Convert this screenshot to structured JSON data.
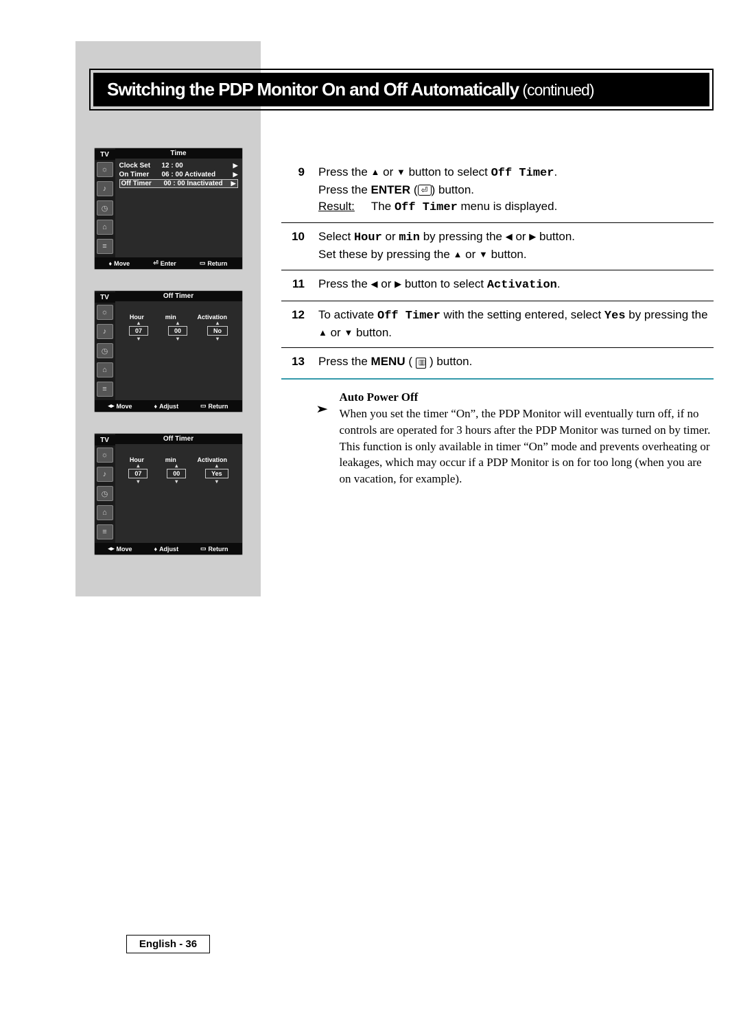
{
  "title_main": "Switching the PDP Monitor On and Off Automatically",
  "title_cont": " (continued)",
  "osd1": {
    "tv": "TV",
    "header": "Time",
    "rows": [
      {
        "label": "Clock Set",
        "value": "12 : 00"
      },
      {
        "label": "On Timer",
        "value": "06 : 00  Activated"
      },
      {
        "label": "Off Timer",
        "value": "00 : 00  Inactivated"
      }
    ],
    "footer": {
      "move": "Move",
      "mid": "Enter",
      "ret": "Return"
    }
  },
  "osd2": {
    "tv": "TV",
    "header": "Off Timer",
    "cols": {
      "hour": "Hour",
      "min": "min",
      "act": "Activation"
    },
    "vals": {
      "hour": "07",
      "min": "00",
      "act": "No"
    },
    "footer": {
      "move": "Move",
      "mid": "Adjust",
      "ret": "Return"
    }
  },
  "osd3": {
    "tv": "TV",
    "header": "Off Timer",
    "cols": {
      "hour": "Hour",
      "min": "min",
      "act": "Activation"
    },
    "vals": {
      "hour": "07",
      "min": "00",
      "act": "Yes"
    },
    "footer": {
      "move": "Move",
      "mid": "Adjust",
      "ret": "Return"
    }
  },
  "steps": {
    "s9": {
      "num": "9",
      "l1a": "Press the ",
      "l1b": " or ",
      "l1c": " button to select ",
      "l1d": "Off Timer",
      "l2a": "Press the ",
      "l2b": "ENTER",
      "l2c": " button.",
      "res_lbl": "Result:",
      "res_a": "The ",
      "res_b": "Off Timer",
      "res_c": " menu is displayed."
    },
    "s10": {
      "num": "10",
      "l1a": "Select ",
      "l1b": "Hour",
      "l1c": " or ",
      "l1d": "min",
      "l1e": " by pressing the ",
      "l1f": " or ",
      "l1g": " button.",
      "l2a": "Set these by pressing the ",
      "l2b": " or ",
      "l2c": " button."
    },
    "s11": {
      "num": "11",
      "a": "Press the ",
      "b": " or ",
      "c": " button to select ",
      "d": "Activation",
      "e": "."
    },
    "s12": {
      "num": "12",
      "a": "To activate ",
      "b": "Off Timer",
      "c": " with the setting entered, select ",
      "d": "Yes",
      "e": " by pressing the ",
      "f": " or ",
      "g": " button."
    },
    "s13": {
      "num": "13",
      "a": "Press the ",
      "b": "MENU",
      "c": " button."
    }
  },
  "note": {
    "heading": "Auto Power Off",
    "body": "When you set the timer “On”, the PDP Monitor will eventually turn off, if no controls are operated for 3 hours after the PDP Monitor was turned on by timer.\nThis function is only available in timer “On” mode and prevents overheating or leakages, which may occur if a PDP Monitor is on for too long (when you are on vacation, for example)."
  },
  "footer_page": "English - 36"
}
